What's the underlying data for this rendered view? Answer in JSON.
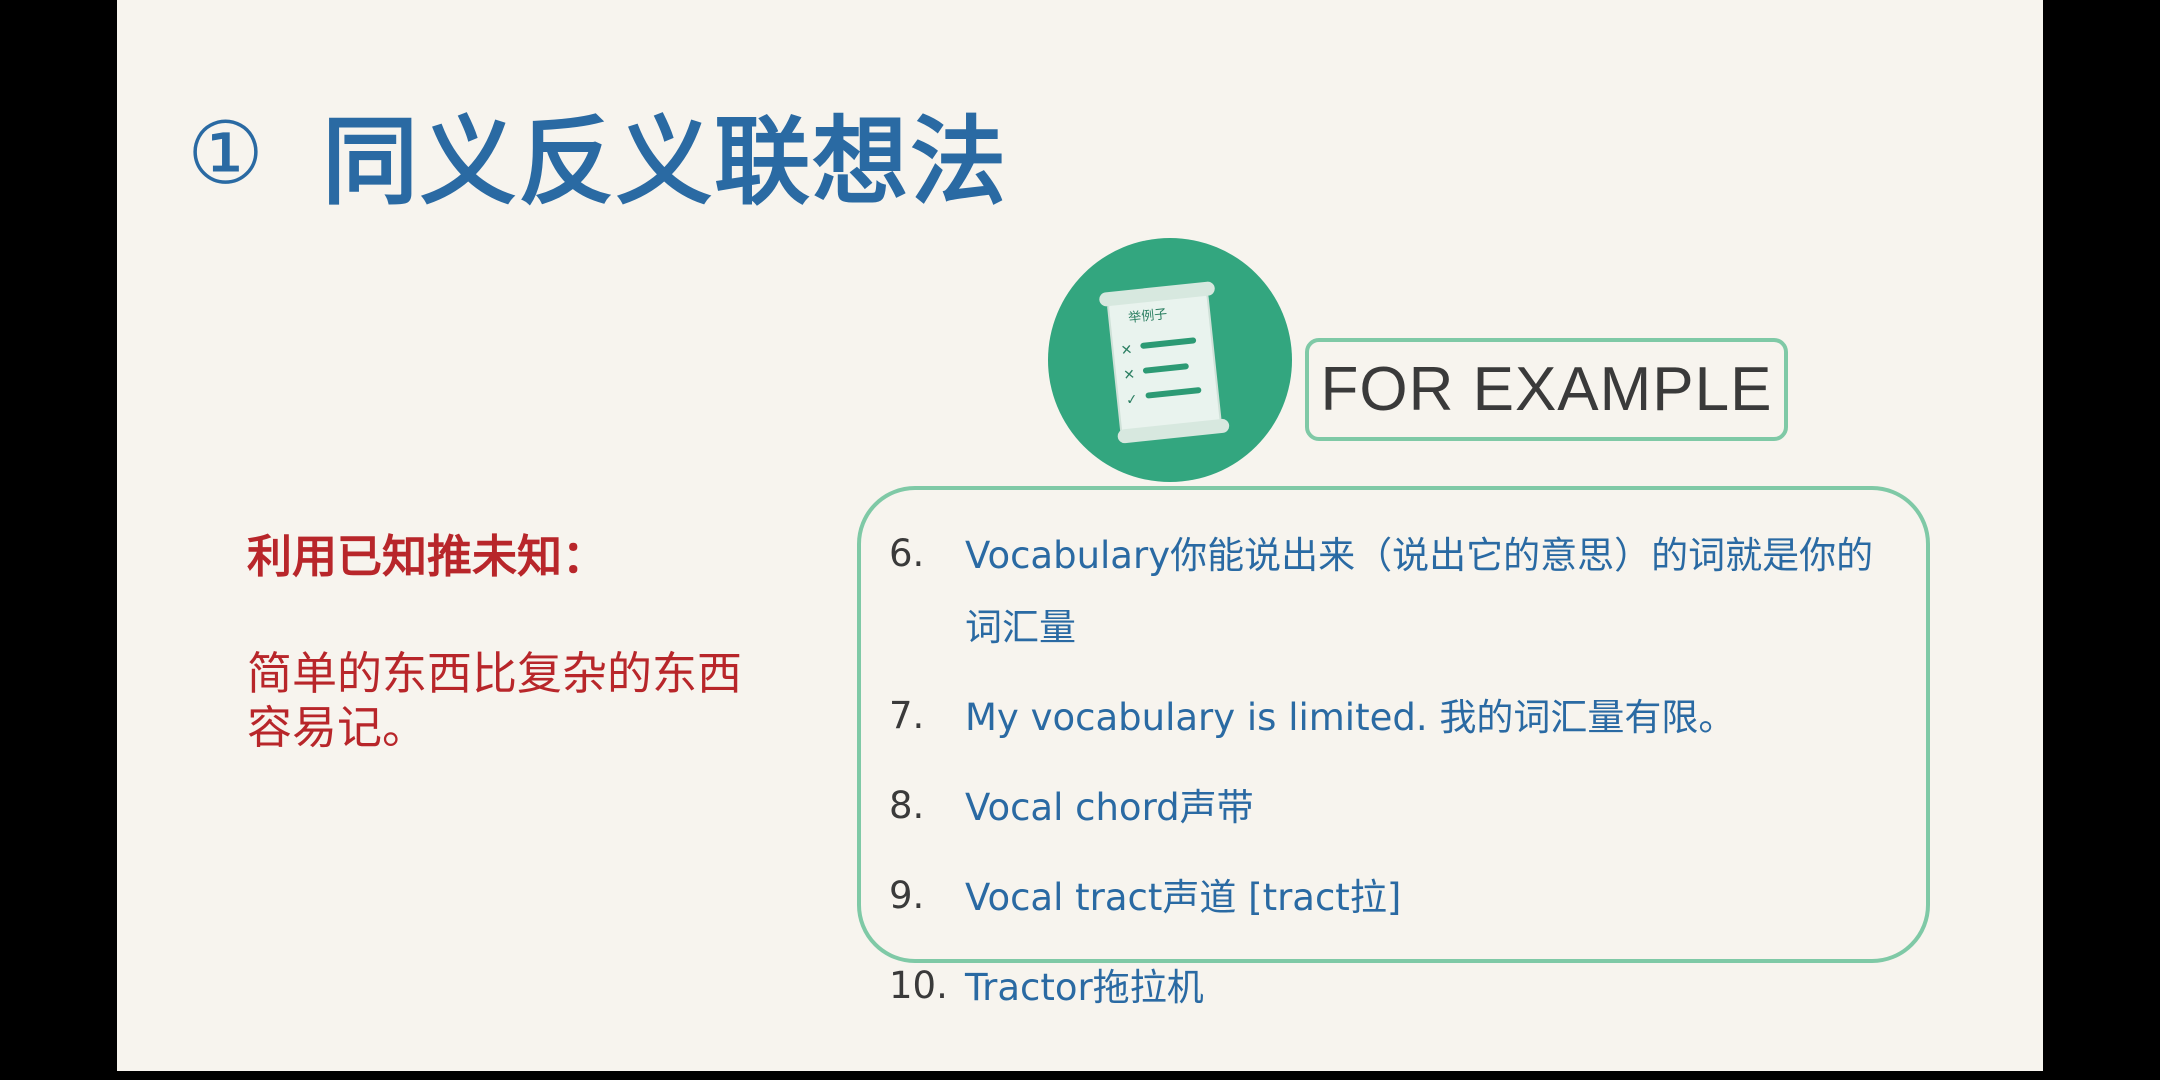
{
  "heading": {
    "number": "①",
    "text": "同义反义联想法"
  },
  "badge": {
    "icon": "scroll-checklist-icon",
    "scroll_label": "举例子",
    "color": "#33a67f"
  },
  "example_label": "FOR EXAMPLE",
  "notes": [
    "利用已知推未知：",
    "简单的东西比复杂的东西容易记。"
  ],
  "examples": [
    {
      "num": "6.",
      "text": "Vocabulary你能说出来（说出它的意思）的词就是你的词汇量"
    },
    {
      "num": "7.",
      "text": "My vocabulary is limited. 我的词汇量有限。"
    },
    {
      "num": "8.",
      "text": "Vocal chord声带"
    },
    {
      "num": "9.",
      "text": "Vocal tract声道 [tract拉]"
    },
    {
      "num": "10.",
      "text": "Tractor拖拉机"
    }
  ],
  "colors": {
    "heading": "#2a6aa3",
    "accent_green": "#7fc9a6",
    "note_red": "#b8262a",
    "slide_bg": "#f7f4ee"
  }
}
